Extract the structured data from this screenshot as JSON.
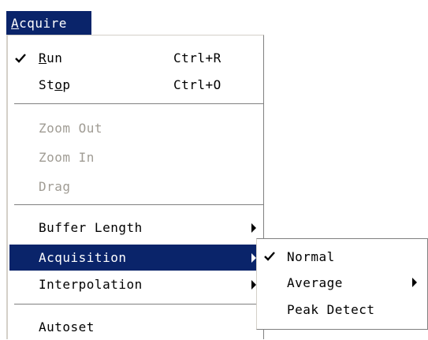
{
  "menubar": {
    "title_letter": "A",
    "title_rest": "cquire"
  },
  "menu": {
    "run": {
      "letter": "R",
      "rest": "un",
      "shortcut": "Ctrl+R",
      "checked": true
    },
    "stop": {
      "pre": "St",
      "letter": "o",
      "rest": "p",
      "shortcut": "Ctrl+O"
    },
    "zoom_out": "Zoom Out",
    "zoom_in": "Zoom In",
    "drag": "Drag",
    "buffer_length": "Buffer Length",
    "acquisition": "Acquisition",
    "interpolation": "Interpolation",
    "autoset": "Autoset"
  },
  "submenu": {
    "normal": "Normal",
    "average": "Average",
    "peak_detect": "Peak Detect"
  },
  "colors": {
    "highlight": "#0a246a",
    "disabled_text": "#a09c94"
  }
}
